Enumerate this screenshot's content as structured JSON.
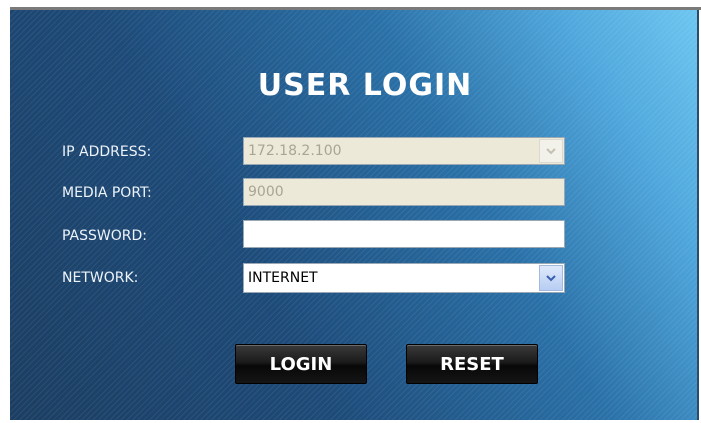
{
  "title": "USER LOGIN",
  "fields": {
    "ip": {
      "label": "IP ADDRESS:",
      "value": "172.18.2.100"
    },
    "port": {
      "label": "MEDIA PORT:",
      "value": "9000"
    },
    "password": {
      "label": "PASSWORD:",
      "value": ""
    },
    "network": {
      "label": "NETWORK:",
      "value": "INTERNET"
    }
  },
  "buttons": {
    "login": "LOGIN",
    "reset": "RESET"
  },
  "icons": {
    "dropdown": "chevron-down-icon"
  },
  "colors": {
    "panel_dark": "#1c3e62",
    "panel_light": "#6dc6f0",
    "button": "#111111"
  }
}
